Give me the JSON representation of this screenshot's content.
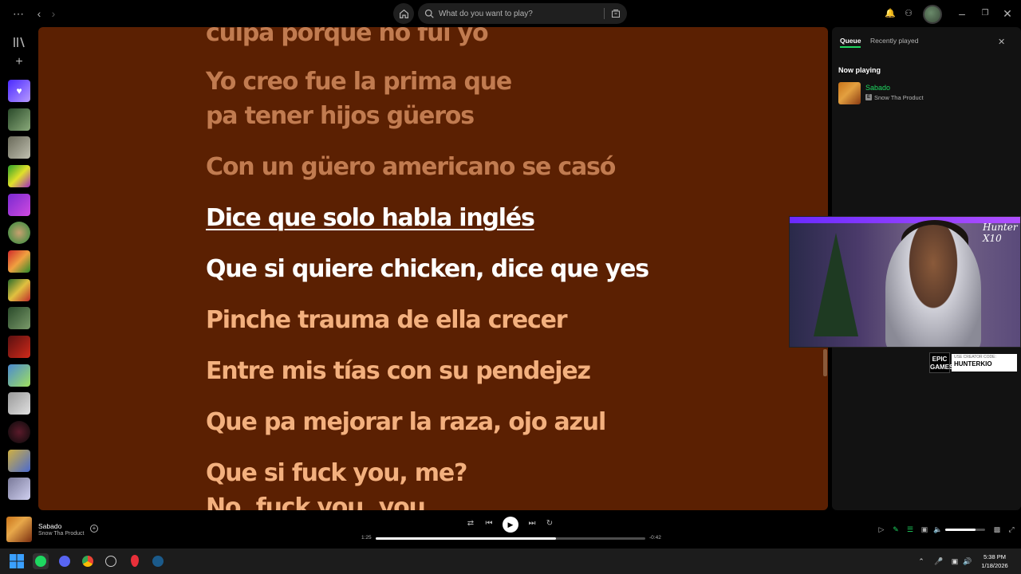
{
  "titlebar": {
    "search_placeholder": "What do you want to play?",
    "icons": [
      "more-icon",
      "back-icon",
      "forward-icon",
      "home-icon",
      "search-icon",
      "browse-icon",
      "bell-icon",
      "friends-icon",
      "minimize-icon",
      "maximize-icon",
      "close-icon"
    ]
  },
  "sidebar": {
    "icons": [
      "library-icon",
      "plus-icon"
    ],
    "playlists": [
      "liked-songs",
      "playlist-2",
      "playlist-3",
      "playlist-4",
      "playlist-5",
      "playlist-6",
      "playlist-7",
      "playlist-8",
      "playlist-9",
      "playlist-10",
      "playlist-11",
      "playlist-12",
      "playlist-13",
      "playlist-14",
      "playlist-15"
    ]
  },
  "lyrics": {
    "past": [
      "culpa porque no fui yo",
      "Yo creo fue la prima que",
      "pa tener hijos güeros",
      "Con un güero americano se casó"
    ],
    "current": [
      "Dice que solo habla inglés",
      "Que si quiere chicken, dice que yes"
    ],
    "upcoming": [
      "Pinche trauma de ella crecer",
      "Entre mis tías con su pendejez",
      "Que pa mejorar la raza, ojo azul",
      "Que si fuck you, me?",
      "No, fuck you, you"
    ]
  },
  "queue": {
    "tabs": [
      "Queue",
      "Recently played"
    ],
    "active_tab": "Queue",
    "section": "Now playing",
    "track": {
      "title": "Sabado",
      "explicit": "E",
      "artist": "Snow Tha Product"
    }
  },
  "overlay": {
    "signature": "Hunter X10",
    "epic_logo": "EPIC GAMES",
    "creator_code_label": "USE CREATOR CODE:",
    "creator_code": "HUNTERKIO"
  },
  "player": {
    "title": "Sabado",
    "artist": "Snow Tha Product",
    "elapsed": "1:25",
    "remaining": "-0:42",
    "progress_fraction": 0.67,
    "volume_fraction": 0.75
  },
  "taskbar": {
    "time": "5:38 PM",
    "date": "1/18/2026"
  },
  "colors": {
    "lyrics_bg": "#5b2002",
    "accent": "#1ed760",
    "panel": "#121212"
  }
}
